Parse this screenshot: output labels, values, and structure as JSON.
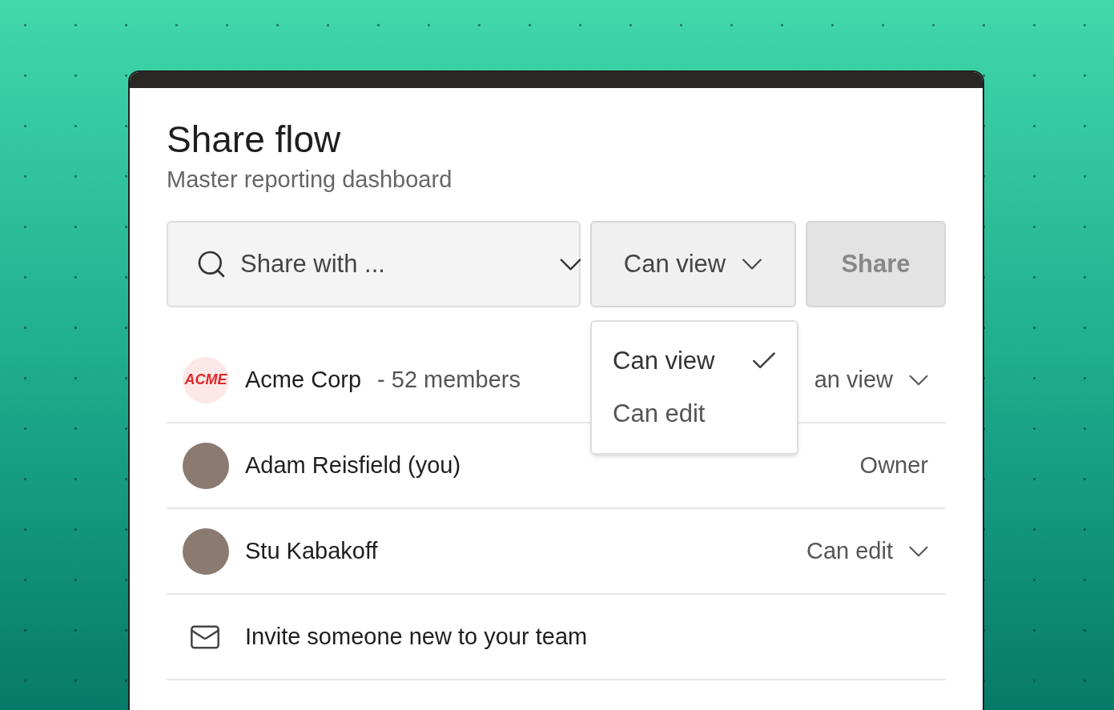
{
  "dialog": {
    "title": "Share flow",
    "subtitle": "Master reporting dashboard"
  },
  "share_field": {
    "placeholder": "Share with ..."
  },
  "permission_select": {
    "value": "Can view",
    "expanded": true
  },
  "share_button": {
    "label": "Share",
    "disabled": true
  },
  "permission_menu": [
    {
      "label": "Can view",
      "selected": true
    },
    {
      "label": "Can edit",
      "selected": false
    }
  ],
  "members": [
    {
      "kind": "org",
      "logo": "ACME",
      "name": "Acme Corp",
      "detail": "- 52 members",
      "role": "an view",
      "has_dropdown": true
    },
    {
      "kind": "person",
      "name": "Adam Reisfield (you)",
      "role": "Owner",
      "has_dropdown": false
    },
    {
      "kind": "person",
      "name": "Stu Kabakoff",
      "role": "Can edit",
      "has_dropdown": true
    }
  ],
  "invite": {
    "label": "Invite someone new to your team"
  }
}
